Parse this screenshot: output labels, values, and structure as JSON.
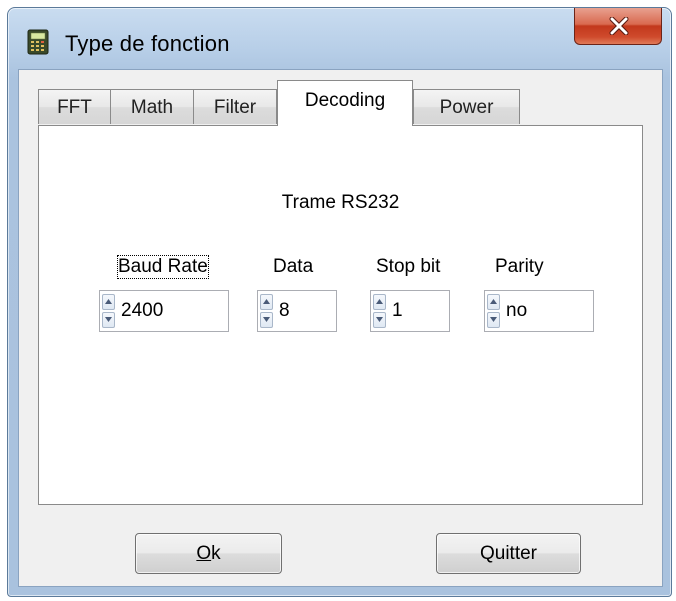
{
  "window": {
    "title": "Type de fonction",
    "icon": "calculator-icon",
    "close_icon": "close-x-icon"
  },
  "tabs": [
    {
      "label": "FFT",
      "active": false
    },
    {
      "label": "Math",
      "active": false
    },
    {
      "label": "Filter",
      "active": false
    },
    {
      "label": "Decoding",
      "active": true
    },
    {
      "label": "Power",
      "active": false
    }
  ],
  "panel": {
    "title": "Trame RS232",
    "fields": [
      {
        "label": "Baud Rate",
        "value": "2400"
      },
      {
        "label": "Data",
        "value": "8"
      },
      {
        "label": "Stop bit",
        "value": "1"
      },
      {
        "label": "Parity",
        "value": "no"
      }
    ]
  },
  "buttons": {
    "ok_label": "Ok",
    "quit_label": "Quitter"
  },
  "colors": {
    "close_button": "#c2381c",
    "title_bar": "#b8cfe8"
  }
}
